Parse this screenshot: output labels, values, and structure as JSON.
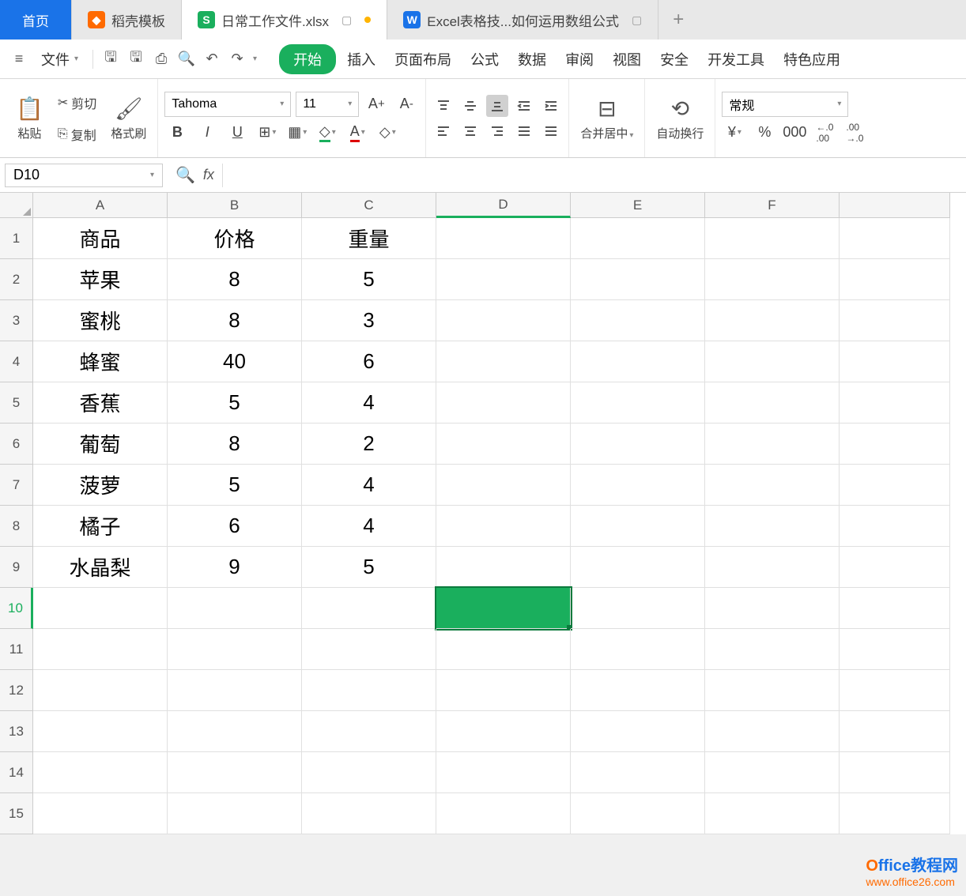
{
  "tabs": {
    "home": "首页",
    "template": "稻壳模板",
    "file": "日常工作文件.xlsx",
    "article": "Excel表格技...如何运用数组公式"
  },
  "menubar": {
    "file": "文件",
    "items": [
      "开始",
      "插入",
      "页面布局",
      "公式",
      "数据",
      "审阅",
      "视图",
      "安全",
      "开发工具",
      "特色应用"
    ]
  },
  "toolbar": {
    "paste": "粘贴",
    "cut": "剪切",
    "copy": "复制",
    "format_painter": "格式刷",
    "font_name": "Tahoma",
    "font_size": "11",
    "merge_center": "合并居中",
    "wrap_text": "自动换行",
    "number_format": "常规"
  },
  "formula_bar": {
    "name_box": "D10",
    "fx": "fx"
  },
  "columns": [
    "A",
    "B",
    "C",
    "D",
    "E",
    "F"
  ],
  "rows": [
    "1",
    "2",
    "3",
    "4",
    "5",
    "6",
    "7",
    "8",
    "9",
    "10",
    "11",
    "12",
    "13",
    "14",
    "15"
  ],
  "selected_cell": "D10",
  "grid": {
    "headers": [
      "商品",
      "价格",
      "重量"
    ],
    "data": [
      [
        "苹果",
        "8",
        "5"
      ],
      [
        "蜜桃",
        "8",
        "3"
      ],
      [
        "蜂蜜",
        "40",
        "6"
      ],
      [
        "香蕉",
        "5",
        "4"
      ],
      [
        "葡萄",
        "8",
        "2"
      ],
      [
        "菠萝",
        "5",
        "4"
      ],
      [
        "橘子",
        "6",
        "4"
      ],
      [
        "水晶梨",
        "9",
        "5"
      ]
    ]
  },
  "watermark": {
    "title": "Office教程网",
    "url": "www.office26.com"
  }
}
